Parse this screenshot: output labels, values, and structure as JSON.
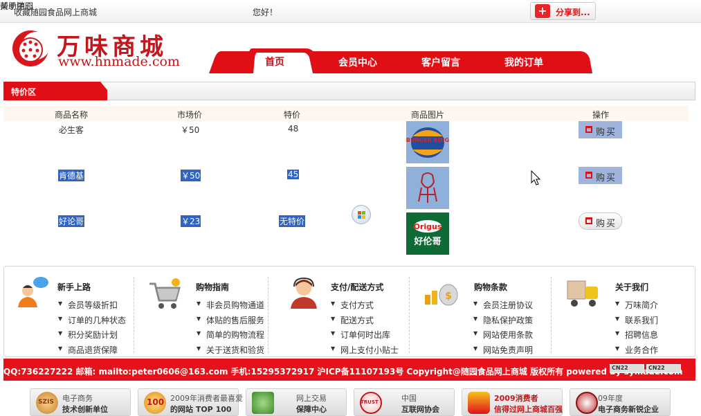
{
  "topbar": {
    "favorite": "收藏随园食品网上商城",
    "greeting": "您好！",
    "share": "分享到...",
    "about": "关于随园",
    "help": "帮助中心"
  },
  "logo": {
    "name": "万味商城",
    "url": "www.hnmade.com"
  },
  "nav": {
    "items": [
      "首页",
      "会员中心",
      "客户留言",
      "我的订单"
    ],
    "active_index": 0
  },
  "section": {
    "title": "特价区"
  },
  "table": {
    "headers": [
      "商品名称",
      "市场价",
      "特价",
      "商品图片",
      "操作"
    ],
    "rows": [
      {
        "name": "必生客",
        "market_price": "￥50",
        "special_price": "48",
        "image": "burger-king-logo",
        "action": "购买",
        "selected": false
      },
      {
        "name": "肯德基",
        "market_price": "￥50",
        "special_price": "45",
        "image": "kfc-logo",
        "action": "购买",
        "selected": true
      },
      {
        "name": "好论哥",
        "market_price": "￥23",
        "special_price": "无特价",
        "image": "orgus-logo",
        "action": "购买",
        "selected": true
      }
    ]
  },
  "images": {
    "burger_king": "BURGER KING",
    "orgus": "Origus",
    "orgus_cn": "好伦哥"
  },
  "info_columns": [
    {
      "title": "新手上路",
      "icon": "newcomer-icon",
      "links": [
        "会员等级折扣",
        "订单的几种状态",
        "积分奖励计划",
        "商品退货保障"
      ]
    },
    {
      "title": "购物指南",
      "icon": "shopping-cart-icon",
      "links": [
        "非会员购物通道",
        "体贴的售后服务",
        "简单的购物流程",
        "关于送货和验货"
      ]
    },
    {
      "title": "支付/配送方式",
      "icon": "customer-service-icon",
      "links": [
        "支付方式",
        "配送方式",
        "订单何时出库",
        "网上支付小贴士"
      ]
    },
    {
      "title": "购物条款",
      "icon": "money-bag-icon",
      "links": [
        "会员注册协议",
        "隐私保护政策",
        "网站使用条款",
        "网站免责声明"
      ]
    },
    {
      "title": "关于我们",
      "icon": "delivery-truck-icon",
      "links": [
        "万味简介",
        "联系我们",
        "招聘信息",
        "业务合作"
      ]
    }
  ],
  "copyright": "QQ:736227222 邮箱: mailto:peter0606@163.com 手机:15295372917 沪ICP备11107193号 Copyright@随园食品网上商城 版权所有 powered by symade.com",
  "cn_badges": [
    "CN22",
    "CN22"
  ],
  "badges": [
    {
      "seal": "SZIS",
      "line1": "电子商务",
      "line2": "技术创新单位"
    },
    {
      "seal": "100",
      "line1": "2009年消费者最喜爱",
      "line2": "的网站 TOP 100"
    },
    {
      "seal": "",
      "line1": "网上交易",
      "line2": "保障中心"
    },
    {
      "seal": "TRUST",
      "line1": "中国",
      "line2": "互联网协会"
    },
    {
      "seal": "",
      "line1": "2009消费者",
      "line2": "信得过网上商城百强"
    },
    {
      "seal": "",
      "line1": "09年度",
      "line2": "电子商务新锐企业"
    }
  ],
  "colors": {
    "brand_red": "#c4161c",
    "strip_red": "#e5111b",
    "selection_blue": "#3164c0"
  }
}
